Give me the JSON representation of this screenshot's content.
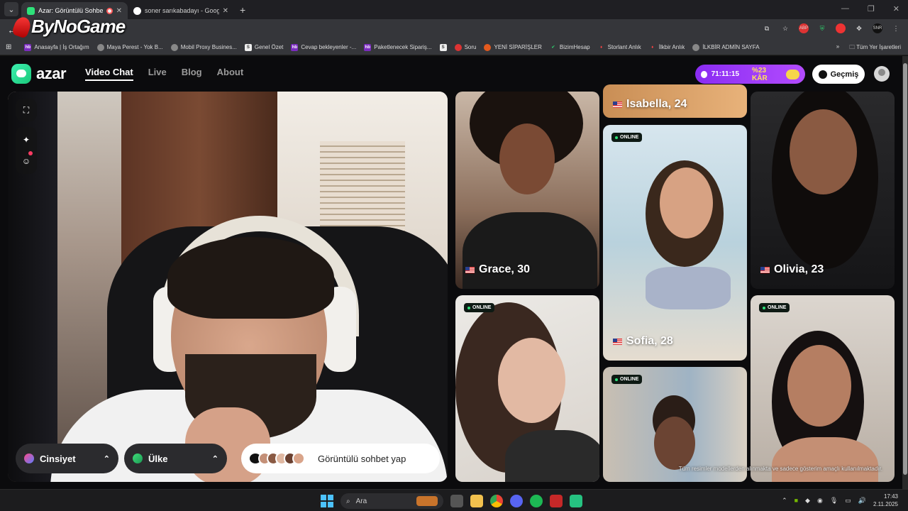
{
  "browser": {
    "tabs": [
      {
        "title": "Azar: Görüntülü Sohbet, Ye",
        "active": true,
        "favicon_color": "#2ee27a"
      },
      {
        "title": "soner sarıkabadayı - Google'da",
        "active": false,
        "favicon_color": "#ffffff"
      }
    ],
    "new_tab": "+",
    "watermark": "ByNoGame",
    "bookmarks": [
      {
        "label": "Anasayfa | İş Ortağım",
        "icon": "hb"
      },
      {
        "label": "Maya Perest - Yok B...",
        "icon": "globe"
      },
      {
        "label": "Mobil Proxy Busines...",
        "icon": "globe"
      },
      {
        "label": "Genel Özet",
        "icon": "S"
      },
      {
        "label": "Cevap bekleyenler -...",
        "icon": "hb"
      },
      {
        "label": "Paketlenecek Sipariş...",
        "icon": "hb"
      },
      {
        "label": "",
        "icon": "S"
      },
      {
        "label": "Soru",
        "icon": "target"
      },
      {
        "label": "YENİ SİPARİŞLER",
        "icon": "fire"
      },
      {
        "label": "BizimHesap",
        "icon": "check"
      },
      {
        "label": "Storlant Anlık",
        "icon": "flame"
      },
      {
        "label": "İlkbir Anlık",
        "icon": "flame"
      },
      {
        "label": "İLKBİR ADMİN SAYFA",
        "icon": "globe"
      }
    ],
    "bookmarks_overflow": "»",
    "all_bookmarks": "Tüm Yer İşaretleri"
  },
  "header": {
    "brand": "azar",
    "nav": [
      {
        "label": "Video Chat",
        "active": true
      },
      {
        "label": "Live",
        "active": false
      },
      {
        "label": "Blog",
        "active": false
      },
      {
        "label": "About",
        "active": false
      }
    ],
    "promo": {
      "timer": "71:11:15",
      "discount": "%23 KÂR"
    },
    "history_label": "Geçmiş"
  },
  "controls": {
    "gender_label": "Cinsiyet",
    "country_label": "Ülke",
    "start_label": "Görüntülü sohbet yap",
    "chevron": "⌃"
  },
  "profiles": [
    {
      "name": "Isabella, 24",
      "online": false
    },
    {
      "name": "Grace, 30",
      "online": false
    },
    {
      "name": "Olivia, 23",
      "online": false
    },
    {
      "name": "Sofia, 28",
      "online": true
    },
    {
      "name": "",
      "online": true
    },
    {
      "name": "",
      "online": true
    },
    {
      "name": "",
      "online": true
    }
  ],
  "online_label": "ONLINE",
  "disclaimer": "Tüm resimler modellerden alınmakta ve sadece gösterim amaçlı kullanılmaktadır.",
  "taskbar": {
    "search_placeholder": "Ara",
    "time": "17:43",
    "date": "2.11.2025"
  },
  "colors": {
    "accent_green": "#2ee27a",
    "promo_purple": "#9b3cf7",
    "promo_yellow": "#ffe35a"
  }
}
